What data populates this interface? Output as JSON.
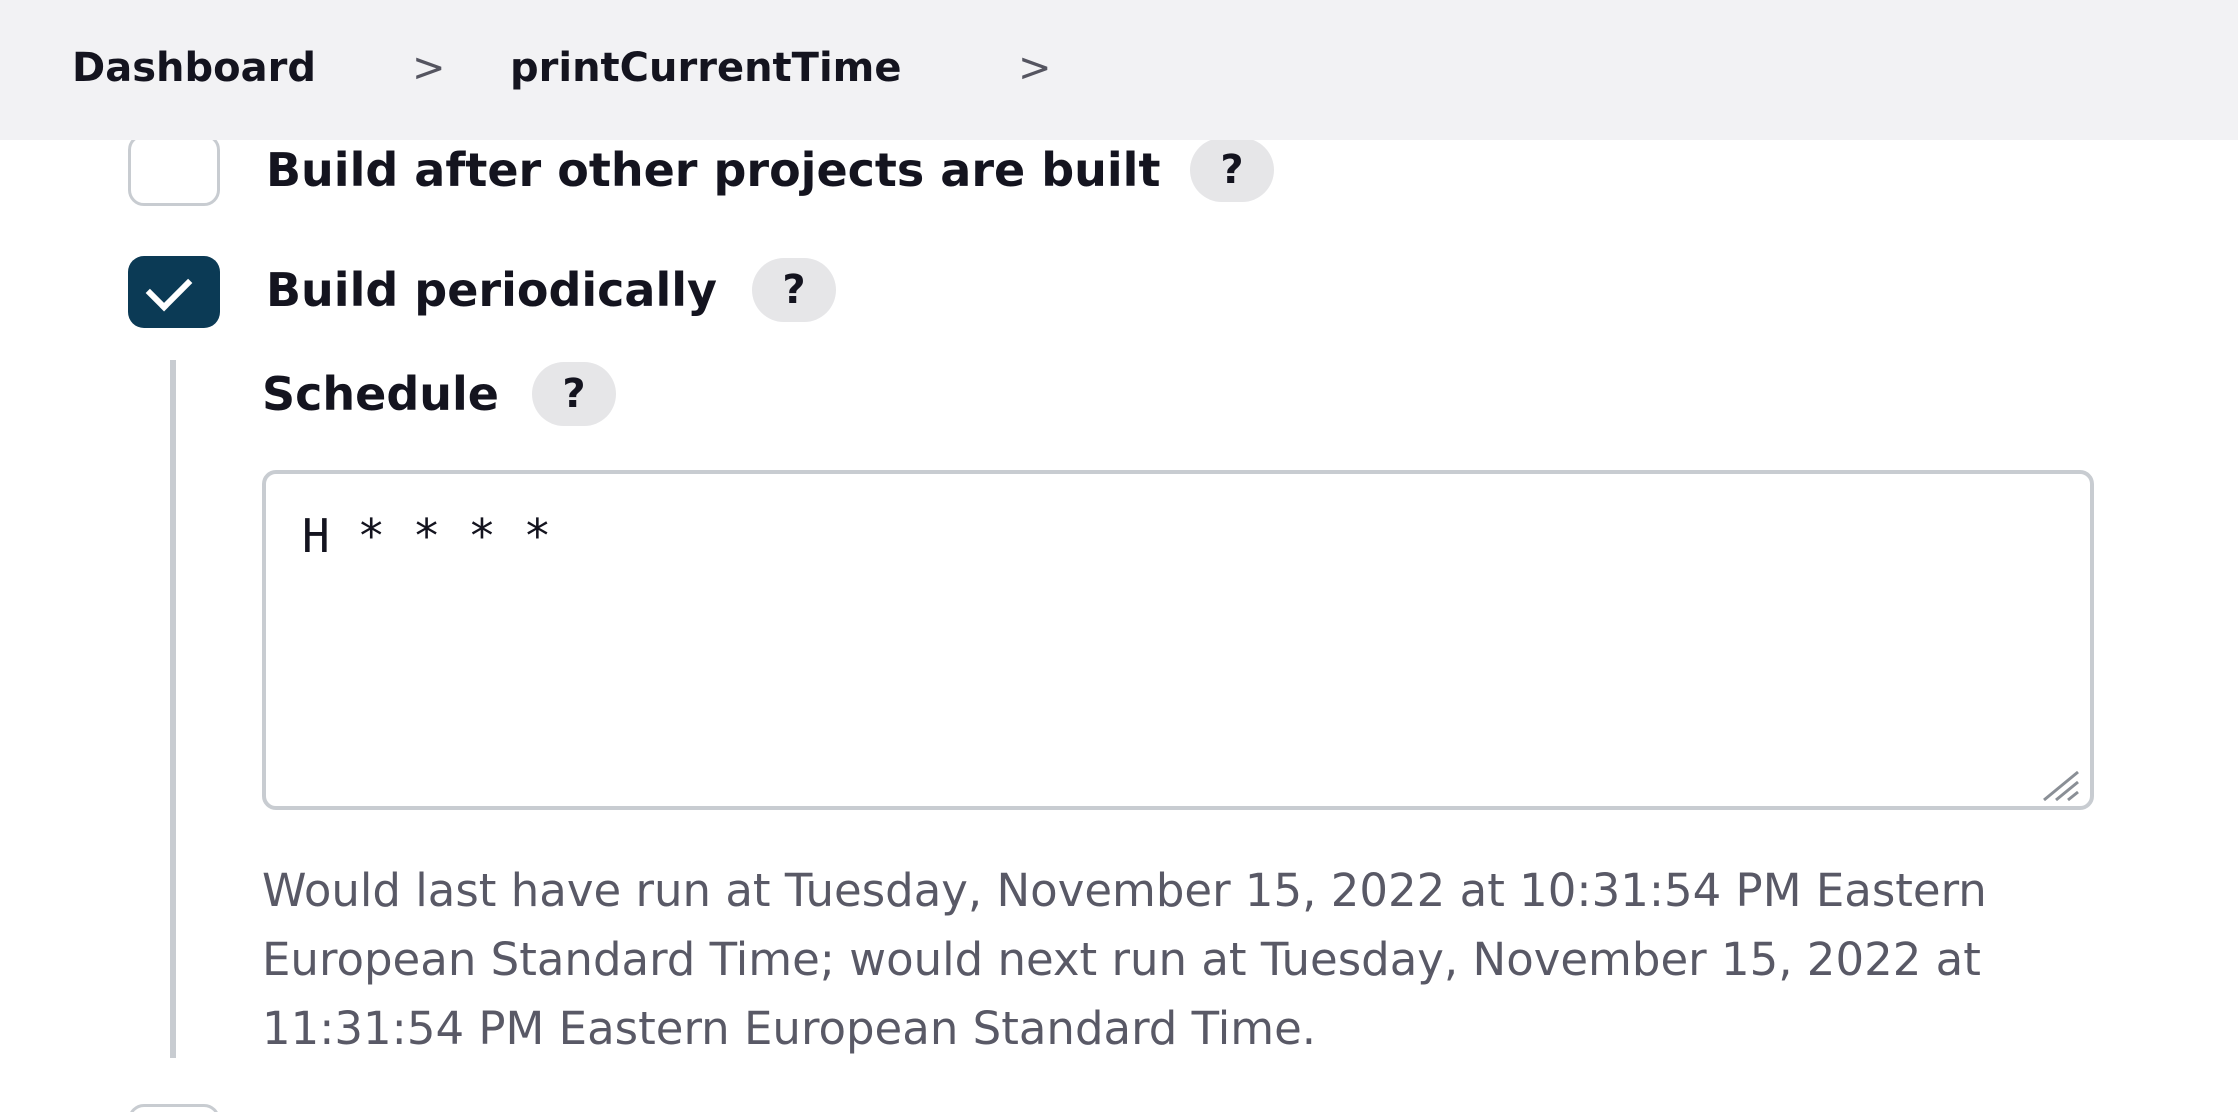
{
  "breadcrumb": {
    "items": [
      "Dashboard",
      "printCurrentTime"
    ],
    "separator": ">"
  },
  "triggers": {
    "build_after_other": {
      "label": "Build after other projects are built",
      "checked": false,
      "help": "?"
    },
    "build_periodically": {
      "label": "Build periodically",
      "checked": true,
      "help": "?"
    }
  },
  "schedule": {
    "label": "Schedule",
    "help": "?",
    "value": "H * * * *",
    "info": "Would last have run at Tuesday, November 15, 2022 at 10:31:54 PM Eastern European Standard Time; would next run at Tuesday, November 15, 2022 at 11:31:54 PM Eastern European Standard Time."
  },
  "colors": {
    "accent": "#0b3a55",
    "header_bg": "#f2f2f4",
    "border": "#c8ccd1",
    "muted_text": "#595966"
  },
  "icons": {
    "separator": "chevron-right-icon",
    "check": "checkmark-icon",
    "resize": "resize-handle-icon"
  }
}
